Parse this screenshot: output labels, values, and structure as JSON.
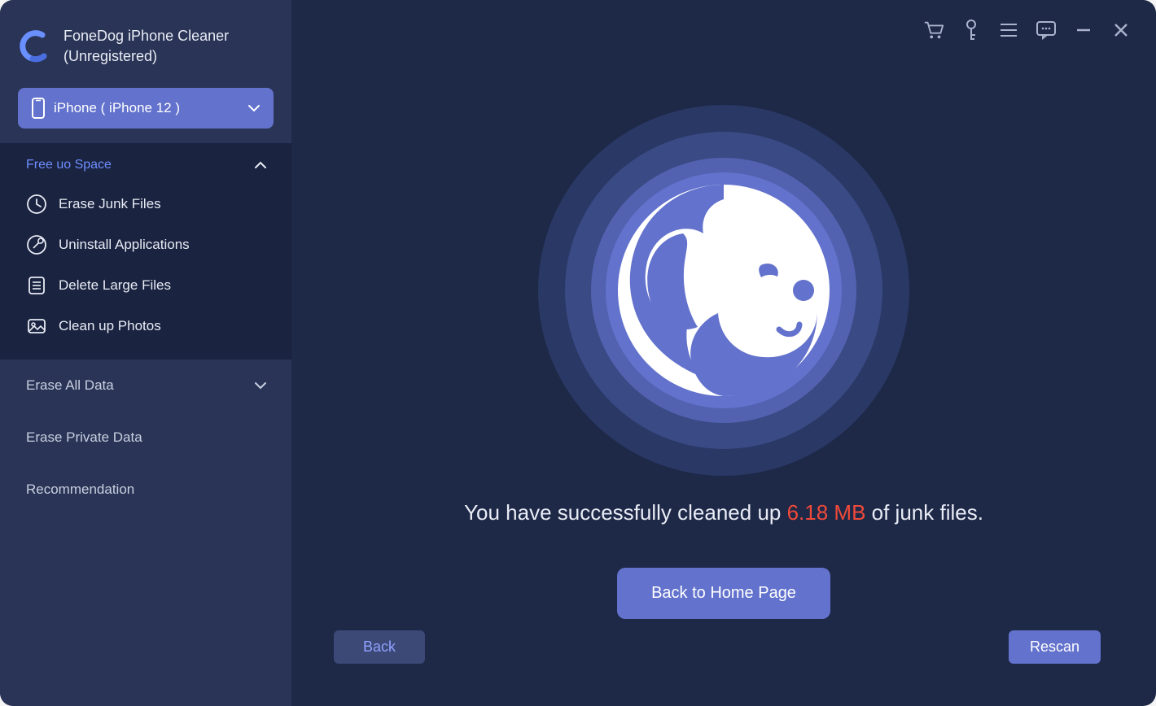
{
  "header": {
    "app_name": "FoneDog iPhone  Cleaner",
    "status": "(Unregistered)"
  },
  "device": {
    "label": "iPhone ( iPhone 12 )"
  },
  "sidebar": {
    "free_up_space": {
      "title": "Free uo Space",
      "expanded": true,
      "items": [
        {
          "label": "Erase Junk Files",
          "icon": "clock"
        },
        {
          "label": "Uninstall Applications",
          "icon": "wrench"
        },
        {
          "label": "Delete Large Files",
          "icon": "list"
        },
        {
          "label": "Clean up Photos",
          "icon": "photo"
        }
      ]
    },
    "erase_all": {
      "label": "Erase All Data",
      "expanded": false
    },
    "erase_private": {
      "label": "Erase Private Data"
    },
    "recommendation": {
      "label": "Recommendation"
    }
  },
  "main": {
    "success_prefix": "You have successfully cleaned up ",
    "success_amount": "6.18 MB",
    "success_suffix": " of junk files.",
    "home_button": "Back to Home Page",
    "back_button": "Back",
    "rescan_button": "Rescan"
  },
  "titlebar_icons": [
    "cart",
    "key",
    "menu",
    "feedback",
    "minimize",
    "close"
  ],
  "colors": {
    "accent": "#6372cc",
    "sidebar_bg": "#2a3456",
    "main_bg": "#1e2847",
    "section_bg": "#1a2340",
    "danger": "#f04a3a"
  }
}
